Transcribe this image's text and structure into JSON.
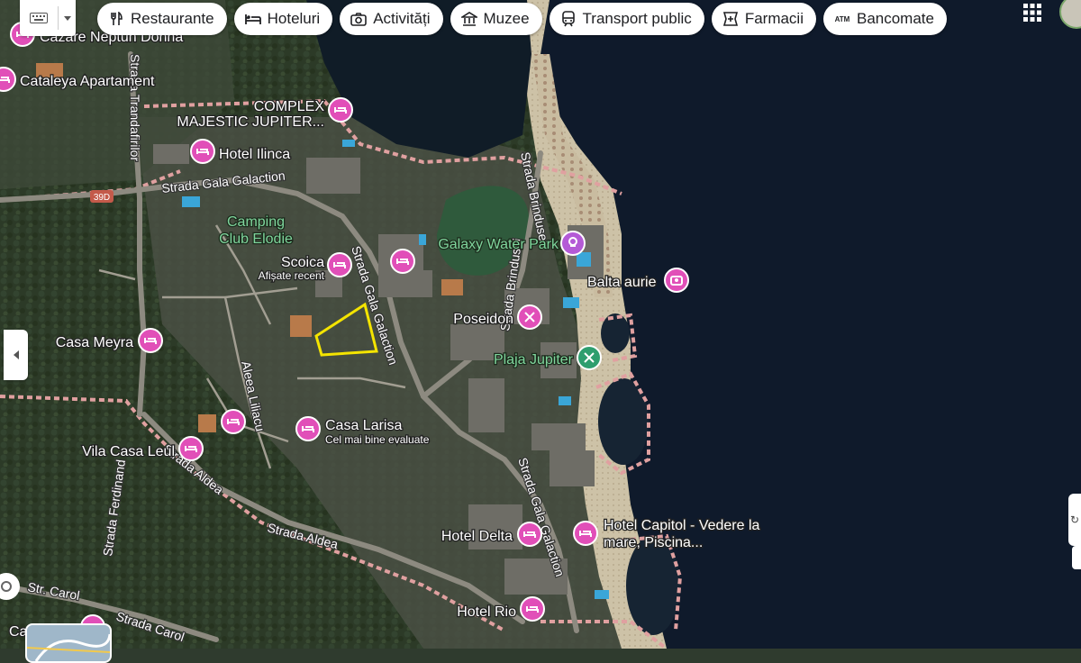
{
  "toolbar": {
    "keyboard_icon": "keyboard-icon",
    "chips": [
      {
        "label": "Restaurante",
        "icon": "fork-knife-icon"
      },
      {
        "label": "Hoteluri",
        "icon": "bed-icon"
      },
      {
        "label": "Activități",
        "icon": "camera-icon"
      },
      {
        "label": "Muzee",
        "icon": "museum-icon"
      },
      {
        "label": "Transport public",
        "icon": "train-icon"
      },
      {
        "label": "Farmacii",
        "icon": "pharmacy-icon"
      },
      {
        "label": "Bancomate",
        "icon": "atm-icon",
        "icon_text": "ATM"
      }
    ]
  },
  "places": {
    "cazare_neptun": "Cazare Neptun Donna",
    "cataleya": "Cataleya Apartament",
    "complex_majestic": [
      "COMPLEX",
      "MAJESTIC JUPITER..."
    ],
    "hotel_ilinca": "Hotel Ilinca",
    "camping": [
      "Camping",
      "Club Elodie"
    ],
    "scoica": "Scoica",
    "scoica_sub": "Afișate recent",
    "galaxy": "Galaxy Water Park",
    "balta_aurie": "Balta aurie",
    "poseidon": "Poseidon",
    "plaja_jupiter": "Plaja Jupiter",
    "casa_meyra": "Casa Meyra",
    "casa_larisa": "Casa Larisa",
    "casa_larisa_sub": "Cel mai bine evaluate",
    "vila_casa_leul": "Vila Casa Leul",
    "hotel_delta": "Hotel Delta",
    "hotel_capitol": [
      "Hotel Capitol - Vedere la",
      "mare, Piscina..."
    ],
    "hotel_rio": "Hotel Rio",
    "ca_partial": "Ca"
  },
  "streets": {
    "tirandafiilor": "Strada Trandafirilor",
    "gala_galaction_1": "Strada Gala Galaction",
    "gala_galaction_2": "Strada Gala Galaction",
    "gala_galaction_3": "Strada Gala Galaction",
    "brindusei_1": "Strada Brindusei",
    "brindusei_2": "Strada Brindusei",
    "aleea_liliacului": "Aleea Liliacu",
    "strada_aldea_1": "Strada Aldea",
    "strada_aldea_2": "Strada Aldea",
    "ferdinand": "Strada Ferdinand",
    "str_carol_1": "Str. Carol",
    "str_carol_2": "Strada Carol",
    "road_shield": "39D"
  },
  "colors": {
    "hotel_pin": "#e14fb8",
    "activity_pin": "#b45ad6",
    "beach_pin": "#2e9e6e",
    "selection_outline": "#f4e400",
    "sea": "#0f1a2b",
    "label_green": "#7fd59c",
    "label_white": "#ffffff"
  }
}
